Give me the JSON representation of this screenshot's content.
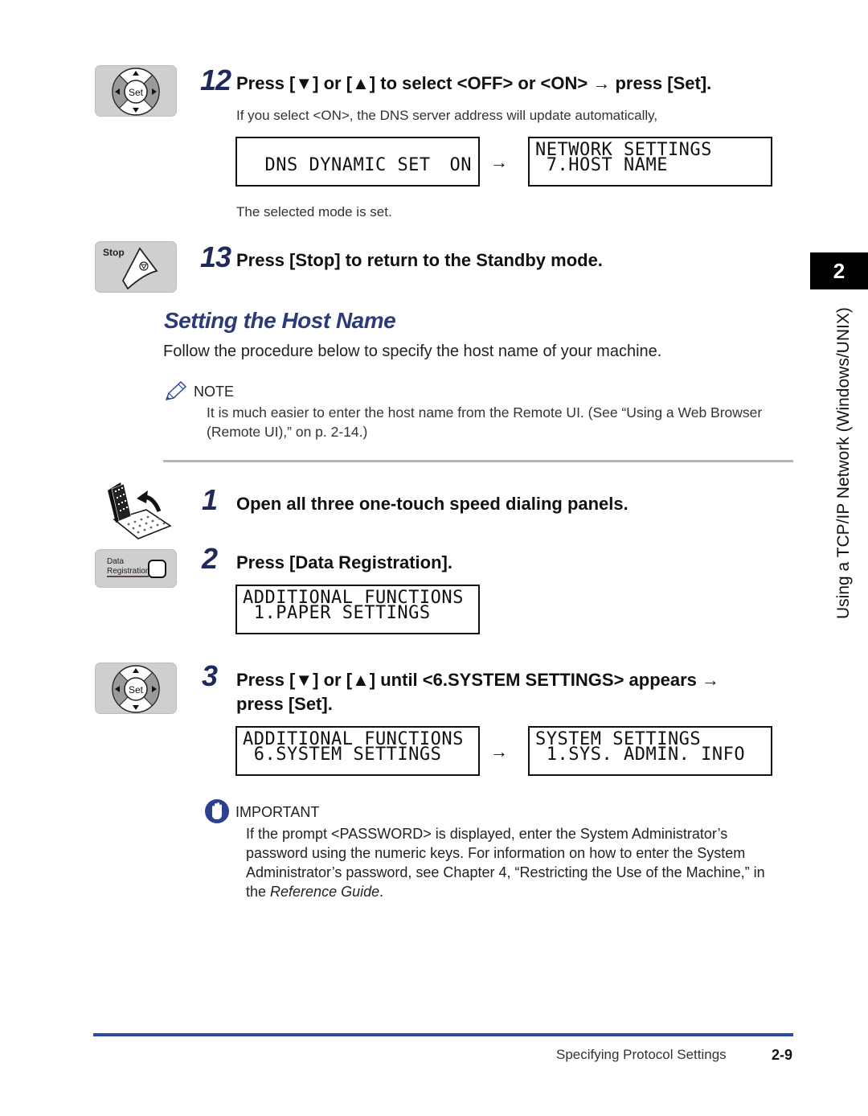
{
  "chapter": {
    "number": "2",
    "side_label": "Using a TCP/IP Network (Windows/UNIX)"
  },
  "steps_top": [
    {
      "number": "12",
      "key_icon": "set-dpad-key",
      "text": "Press [▼] or [▲] to select <OFF> or <ON> → press [Set].",
      "note": "If you select <ON>, the DNS server address will update automatically,",
      "displays": [
        {
          "line1": "DNS DYNAMIC SET",
          "line2": "",
          "right": "ON"
        },
        {
          "line1": "NETWORK SETTINGS",
          "line2": " 7.HOST NAME",
          "right": ""
        }
      ],
      "after": "The selected mode is set."
    },
    {
      "number": "13",
      "key_icon": "stop-key",
      "key_label": "Stop",
      "text": "Press [Stop] to return to the Standby mode."
    }
  ],
  "section": {
    "title": "Setting the Host Name",
    "intro": "Follow the procedure below to specify the host name of your machine.",
    "note_label": "NOTE",
    "note_text_1": "It is much easier to enter the host name from the Remote UI. (See “Using a Web Browser",
    "note_text_2": "(Remote UI),” on p. 2-14.)"
  },
  "steps": [
    {
      "number": "1",
      "key_icon": "one-touch-panel",
      "text": "Open all three one-touch speed dialing panels."
    },
    {
      "number": "2",
      "key_icon": "data-registration-key",
      "key_label_1": "Data",
      "key_label_2": "Registration",
      "text": "Press [Data Registration].",
      "displays": [
        {
          "line1": "ADDITIONAL FUNCTIONS",
          "line2": " 1.PAPER SETTINGS"
        }
      ]
    },
    {
      "number": "3",
      "key_icon": "set-dpad-key",
      "text_1": "Press [▼] or [▲] until <6.SYSTEM SETTINGS> appears →",
      "text_2": "press [Set].",
      "displays": [
        {
          "line1": "ADDITIONAL FUNCTIONS",
          "line2": " 6.SYSTEM SETTINGS"
        },
        {
          "line1": "SYSTEM SETTINGS",
          "line2": " 1.SYS. ADMIN. INFO"
        }
      ]
    }
  ],
  "important": {
    "label": "IMPORTANT",
    "text_1": "If the prompt <PASSWORD> is displayed, enter the System Administrator’s",
    "text_2": "password using the numeric keys. For information on how to enter the System",
    "text_3": "Administrator’s password, see Chapter 4, “Restricting the Use of the Machine,” in",
    "text_4_prefix": "the ",
    "text_4_italic": "Reference Guide",
    "text_4_suffix": "."
  },
  "arrow": "→",
  "set_label": "Set",
  "footer": {
    "section": "Specifying Protocol Settings",
    "page": "2-9"
  },
  "colors": {
    "step_number": "#1f2a5a",
    "section_title": "#2b3a7a",
    "footer_rule": "#2d4b9a",
    "important_icon": "#2d3f8f"
  }
}
